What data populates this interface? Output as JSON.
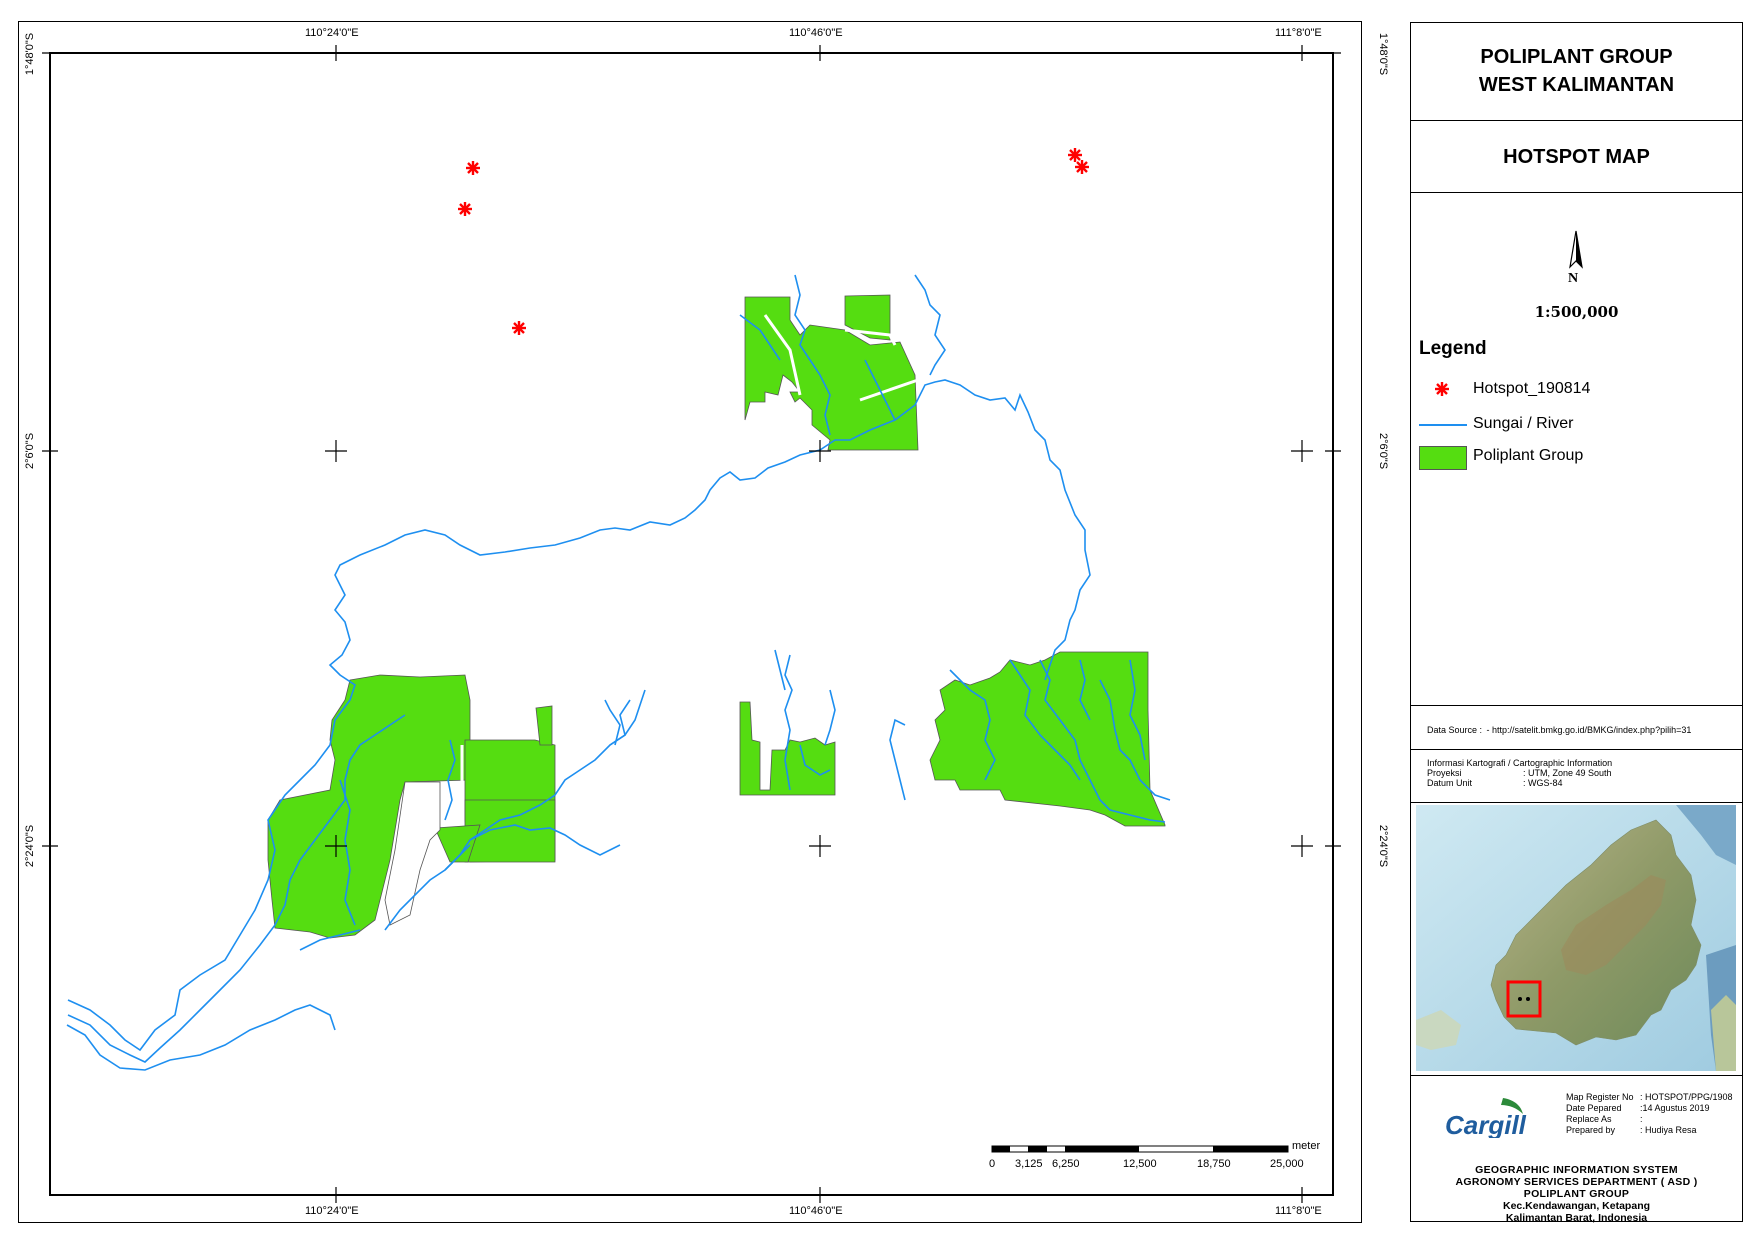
{
  "map": {
    "top_ticks": [
      "110°24'0\"E",
      "110°46'0\"E",
      "111°8'0\"E"
    ],
    "bottom_ticks": [
      "110°24'0\"E",
      "110°46'0\"E",
      "111°8'0\"E"
    ],
    "left_ticks": [
      "1°48'0\"S",
      "2°6'0\"S",
      "2°24'0\"S"
    ],
    "right_ticks": [
      "1°48'0\"S",
      "2°6'0\"S",
      "2°24'0\"S"
    ],
    "scale_unit": "meter",
    "scale_labels": [
      "0",
      "3,125",
      "6,250",
      "12,500",
      "18,750",
      "25,000"
    ],
    "colors": {
      "river": "#1e8ff0",
      "plantation": "#55dd11",
      "hotspot": "#ff0000"
    }
  },
  "header": {
    "line1": "POLIPLANT GROUP",
    "line2": "WEST KALIMANTAN"
  },
  "map_title": "HOTSPOT MAP",
  "north_arrow": {
    "letter": "N"
  },
  "scale_text": "1:500,000",
  "legend": {
    "title": "Legend",
    "items": [
      {
        "label": "Hotspot_190814",
        "icon": "red-asterisk-icon"
      },
      {
        "label": "Sungai / River",
        "icon": "blue-line-icon"
      },
      {
        "label": "Poliplant Group",
        "icon": "green-box-icon"
      }
    ]
  },
  "data_source": {
    "label": "Data Source :",
    "value": "- http://satelit.bmkg.go.id/BMKG/index.php?pilih=31"
  },
  "carto": {
    "heading": "Informasi Kartografi / Cartographic Information",
    "rows": [
      {
        "key": "Proyeksi",
        "value": ": UTM, Zone 49 South"
      },
      {
        "key": "Datum Unit",
        "value": ": WGS-84"
      }
    ]
  },
  "logo_text": "Cargill",
  "register": [
    {
      "key": "Map Register No",
      "value": ": HOTSPOT/PPG/1908"
    },
    {
      "key": "Date Pepared",
      "value": ":14 Agustus 2019"
    },
    {
      "key": "Replace As",
      "value": ":"
    },
    {
      "key": "Prepared by",
      "value": ": Hudiya Resa"
    }
  ],
  "footer": {
    "line1": "GEOGRAPHIC INFORMATION SYSTEM",
    "line2": "AGRONOMY SERVICES DEPARTMENT ( ASD )",
    "line3": "POLIPLANT GROUP",
    "line4": "Kec.Kendawangan, Ketapang",
    "line5": "Kalimantan Barat, Indonesia"
  }
}
